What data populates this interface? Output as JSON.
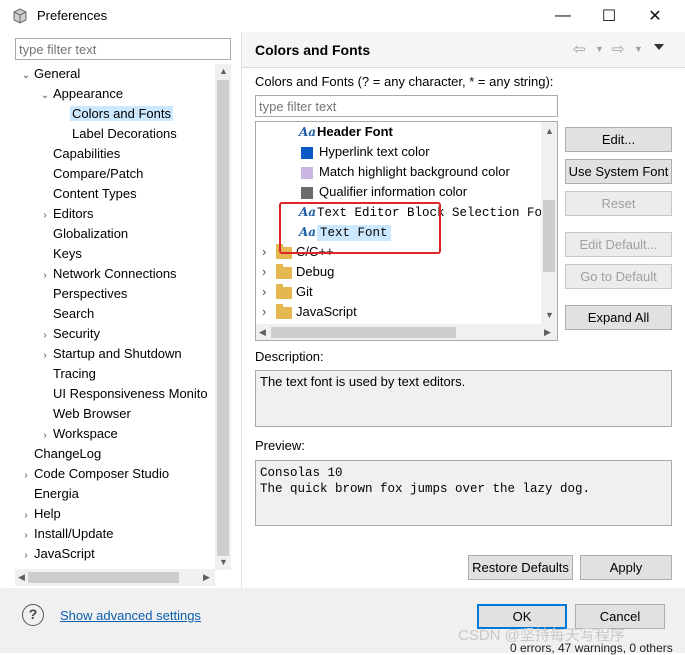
{
  "window": {
    "title": "Preferences",
    "minimize_glyph": "—",
    "maximize_glyph": "☐",
    "close_glyph": "✕"
  },
  "left": {
    "filter_placeholder": "type filter text",
    "tree": [
      {
        "label": "General",
        "depth": 0,
        "toggle": "⌄"
      },
      {
        "label": "Appearance",
        "depth": 1,
        "toggle": "⌄"
      },
      {
        "label": "Colors and Fonts",
        "depth": 2,
        "toggle": "",
        "selected": true
      },
      {
        "label": "Label Decorations",
        "depth": 2,
        "toggle": ""
      },
      {
        "label": "Capabilities",
        "depth": 1,
        "toggle": ""
      },
      {
        "label": "Compare/Patch",
        "depth": 1,
        "toggle": ""
      },
      {
        "label": "Content Types",
        "depth": 1,
        "toggle": ""
      },
      {
        "label": "Editors",
        "depth": 1,
        "toggle": "›"
      },
      {
        "label": "Globalization",
        "depth": 1,
        "toggle": ""
      },
      {
        "label": "Keys",
        "depth": 1,
        "toggle": ""
      },
      {
        "label": "Network Connections",
        "depth": 1,
        "toggle": "›"
      },
      {
        "label": "Perspectives",
        "depth": 1,
        "toggle": ""
      },
      {
        "label": "Search",
        "depth": 1,
        "toggle": ""
      },
      {
        "label": "Security",
        "depth": 1,
        "toggle": "›"
      },
      {
        "label": "Startup and Shutdown",
        "depth": 1,
        "toggle": "›"
      },
      {
        "label": "Tracing",
        "depth": 1,
        "toggle": ""
      },
      {
        "label": "UI Responsiveness Monito",
        "depth": 1,
        "toggle": ""
      },
      {
        "label": "Web Browser",
        "depth": 1,
        "toggle": ""
      },
      {
        "label": "Workspace",
        "depth": 1,
        "toggle": "›"
      },
      {
        "label": "ChangeLog",
        "depth": 0,
        "toggle": ""
      },
      {
        "label": "Code Composer Studio",
        "depth": 0,
        "toggle": "›"
      },
      {
        "label": "Energia",
        "depth": 0,
        "toggle": ""
      },
      {
        "label": "Help",
        "depth": 0,
        "toggle": "›"
      },
      {
        "label": "Install/Update",
        "depth": 0,
        "toggle": "›"
      },
      {
        "label": "JavaScript",
        "depth": 0,
        "toggle": "›"
      }
    ]
  },
  "right": {
    "page_title": "Colors and Fonts",
    "filter_label": "Colors and Fonts (? = any character, * = any string):",
    "filter_placeholder": "type filter text",
    "font_tree": [
      {
        "label": "Header Font",
        "kind": "font",
        "bold": true
      },
      {
        "label": "Hyperlink text color",
        "kind": "color",
        "color": "#0a58c4"
      },
      {
        "label": "Match highlight background color",
        "kind": "color",
        "color": "#c9b6e4"
      },
      {
        "label": "Qualifier information color",
        "kind": "color",
        "color": "#6b6b6b"
      },
      {
        "label": "Text Editor Block Selection Font",
        "kind": "font",
        "mono": true
      },
      {
        "label": "Text Font",
        "kind": "font",
        "mono": true,
        "selected": true
      },
      {
        "label": "C/C++",
        "kind": "folder"
      },
      {
        "label": "Debug",
        "kind": "folder"
      },
      {
        "label": "Git",
        "kind": "folder"
      },
      {
        "label": "JavaScript",
        "kind": "folder"
      }
    ],
    "buttons": {
      "edit": "Edit...",
      "use_system_font": "Use System Font",
      "reset": "Reset",
      "edit_default": "Edit Default...",
      "go_to_default": "Go to Default",
      "expand_all": "Expand All",
      "restore_defaults": "Restore Defaults",
      "apply": "Apply"
    },
    "description_label": "Description:",
    "description_text": "The text font is used by text editors.",
    "preview_label": "Preview:",
    "preview_lines": [
      "Consolas 10",
      "The quick brown fox jumps over the lazy dog."
    ]
  },
  "footer": {
    "help_glyph": "?",
    "advanced_link": "Show advanced settings",
    "ok": "OK",
    "cancel": "Cancel",
    "watermark": "CSDN @坚持每天写程序",
    "status": "0 errors, 47 warnings, 0 others"
  },
  "colors": {
    "selection": "#cce8ff",
    "highlight_box": "#e0242a",
    "link": "#0b5fad"
  }
}
